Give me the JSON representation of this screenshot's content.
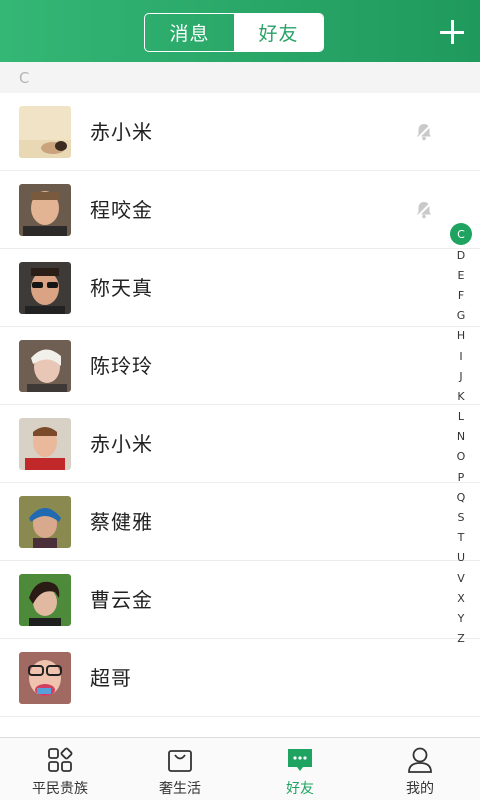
{
  "header": {
    "tabs": [
      {
        "label": "消息",
        "active": false
      },
      {
        "label": "好友",
        "active": true
      }
    ],
    "add_icon": "plus-icon"
  },
  "section": {
    "letter": "C"
  },
  "contacts": [
    {
      "name": "赤小米",
      "muted": true
    },
    {
      "name": "程咬金",
      "muted": true
    },
    {
      "name": "称天真",
      "muted": false
    },
    {
      "name": "陈玲玲",
      "muted": false
    },
    {
      "name": "赤小米",
      "muted": false
    },
    {
      "name": "蔡健雅",
      "muted": false
    },
    {
      "name": "曹云金",
      "muted": false
    },
    {
      "name": "超哥",
      "muted": false
    }
  ],
  "index_letters": [
    "C",
    "D",
    "E",
    "F",
    "G",
    "H",
    "I",
    "J",
    "K",
    "L",
    "N",
    "O",
    "P",
    "Q",
    "S",
    "T",
    "U",
    "V",
    "X",
    "Y",
    "Z"
  ],
  "index_active": "C",
  "tabbar": {
    "items": [
      {
        "label": "平民贵族",
        "icon": "grid-icon",
        "active": false
      },
      {
        "label": "奢生活",
        "icon": "bag-icon",
        "active": false
      },
      {
        "label": "好友",
        "icon": "chat-icon",
        "active": true
      },
      {
        "label": "我的",
        "icon": "person-icon",
        "active": false
      }
    ]
  },
  "colors": {
    "accent": "#1fa360",
    "header_start": "#34b675",
    "header_end": "#1f9a5c"
  }
}
